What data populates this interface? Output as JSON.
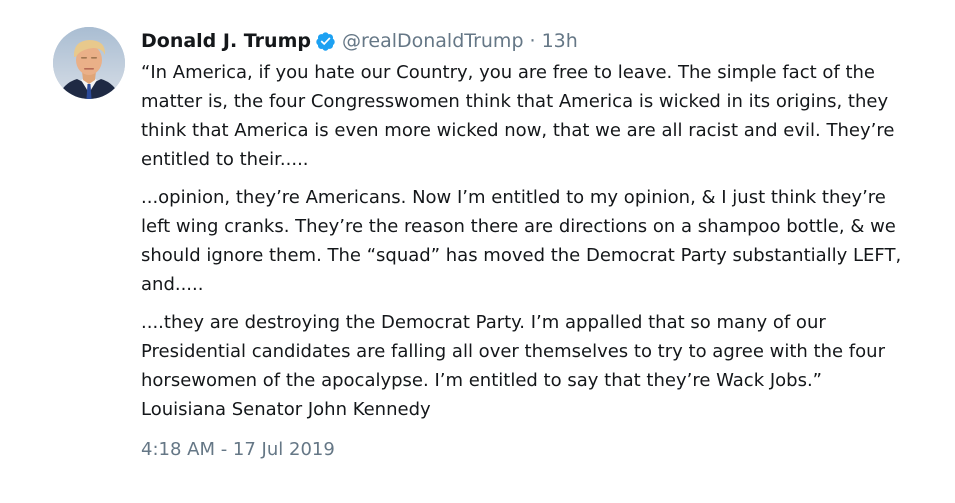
{
  "tweet": {
    "author": {
      "display_name": "Donald J. Trump",
      "handle": "@realDonaldTrump",
      "verified": true,
      "avatar_icon": "profile-photo"
    },
    "separator": "·",
    "time_ago": "13h",
    "paragraphs": [
      "“In America, if you hate our Country, you are free to leave. The simple fact of the matter is, the four Congresswomen think that America is wicked in its origins, they think that America is even more wicked now, that we are all racist and evil. They’re entitled to their.....",
      "...opinion, they’re Americans. Now I’m entitled to my opinion, & I just think they’re left wing cranks. They’re the reason there are directions on a shampoo bottle, & we should ignore them. The “squad” has moved the Democrat Party substantially LEFT, and.....",
      "....they are destroying the Democrat Party. I’m appalled that so many of our Presidential candidates are falling all over themselves to try to agree with the four horsewomen of the apocalypse. I’m entitled to say that they’re Wack Jobs.” Louisiana Senator John Kennedy"
    ],
    "timestamp": "4:18 AM - 17 Jul 2019"
  },
  "colors": {
    "text_primary": "#14171a",
    "text_secondary": "#657786",
    "verified_badge": "#1da1f2",
    "background": "#ffffff"
  }
}
